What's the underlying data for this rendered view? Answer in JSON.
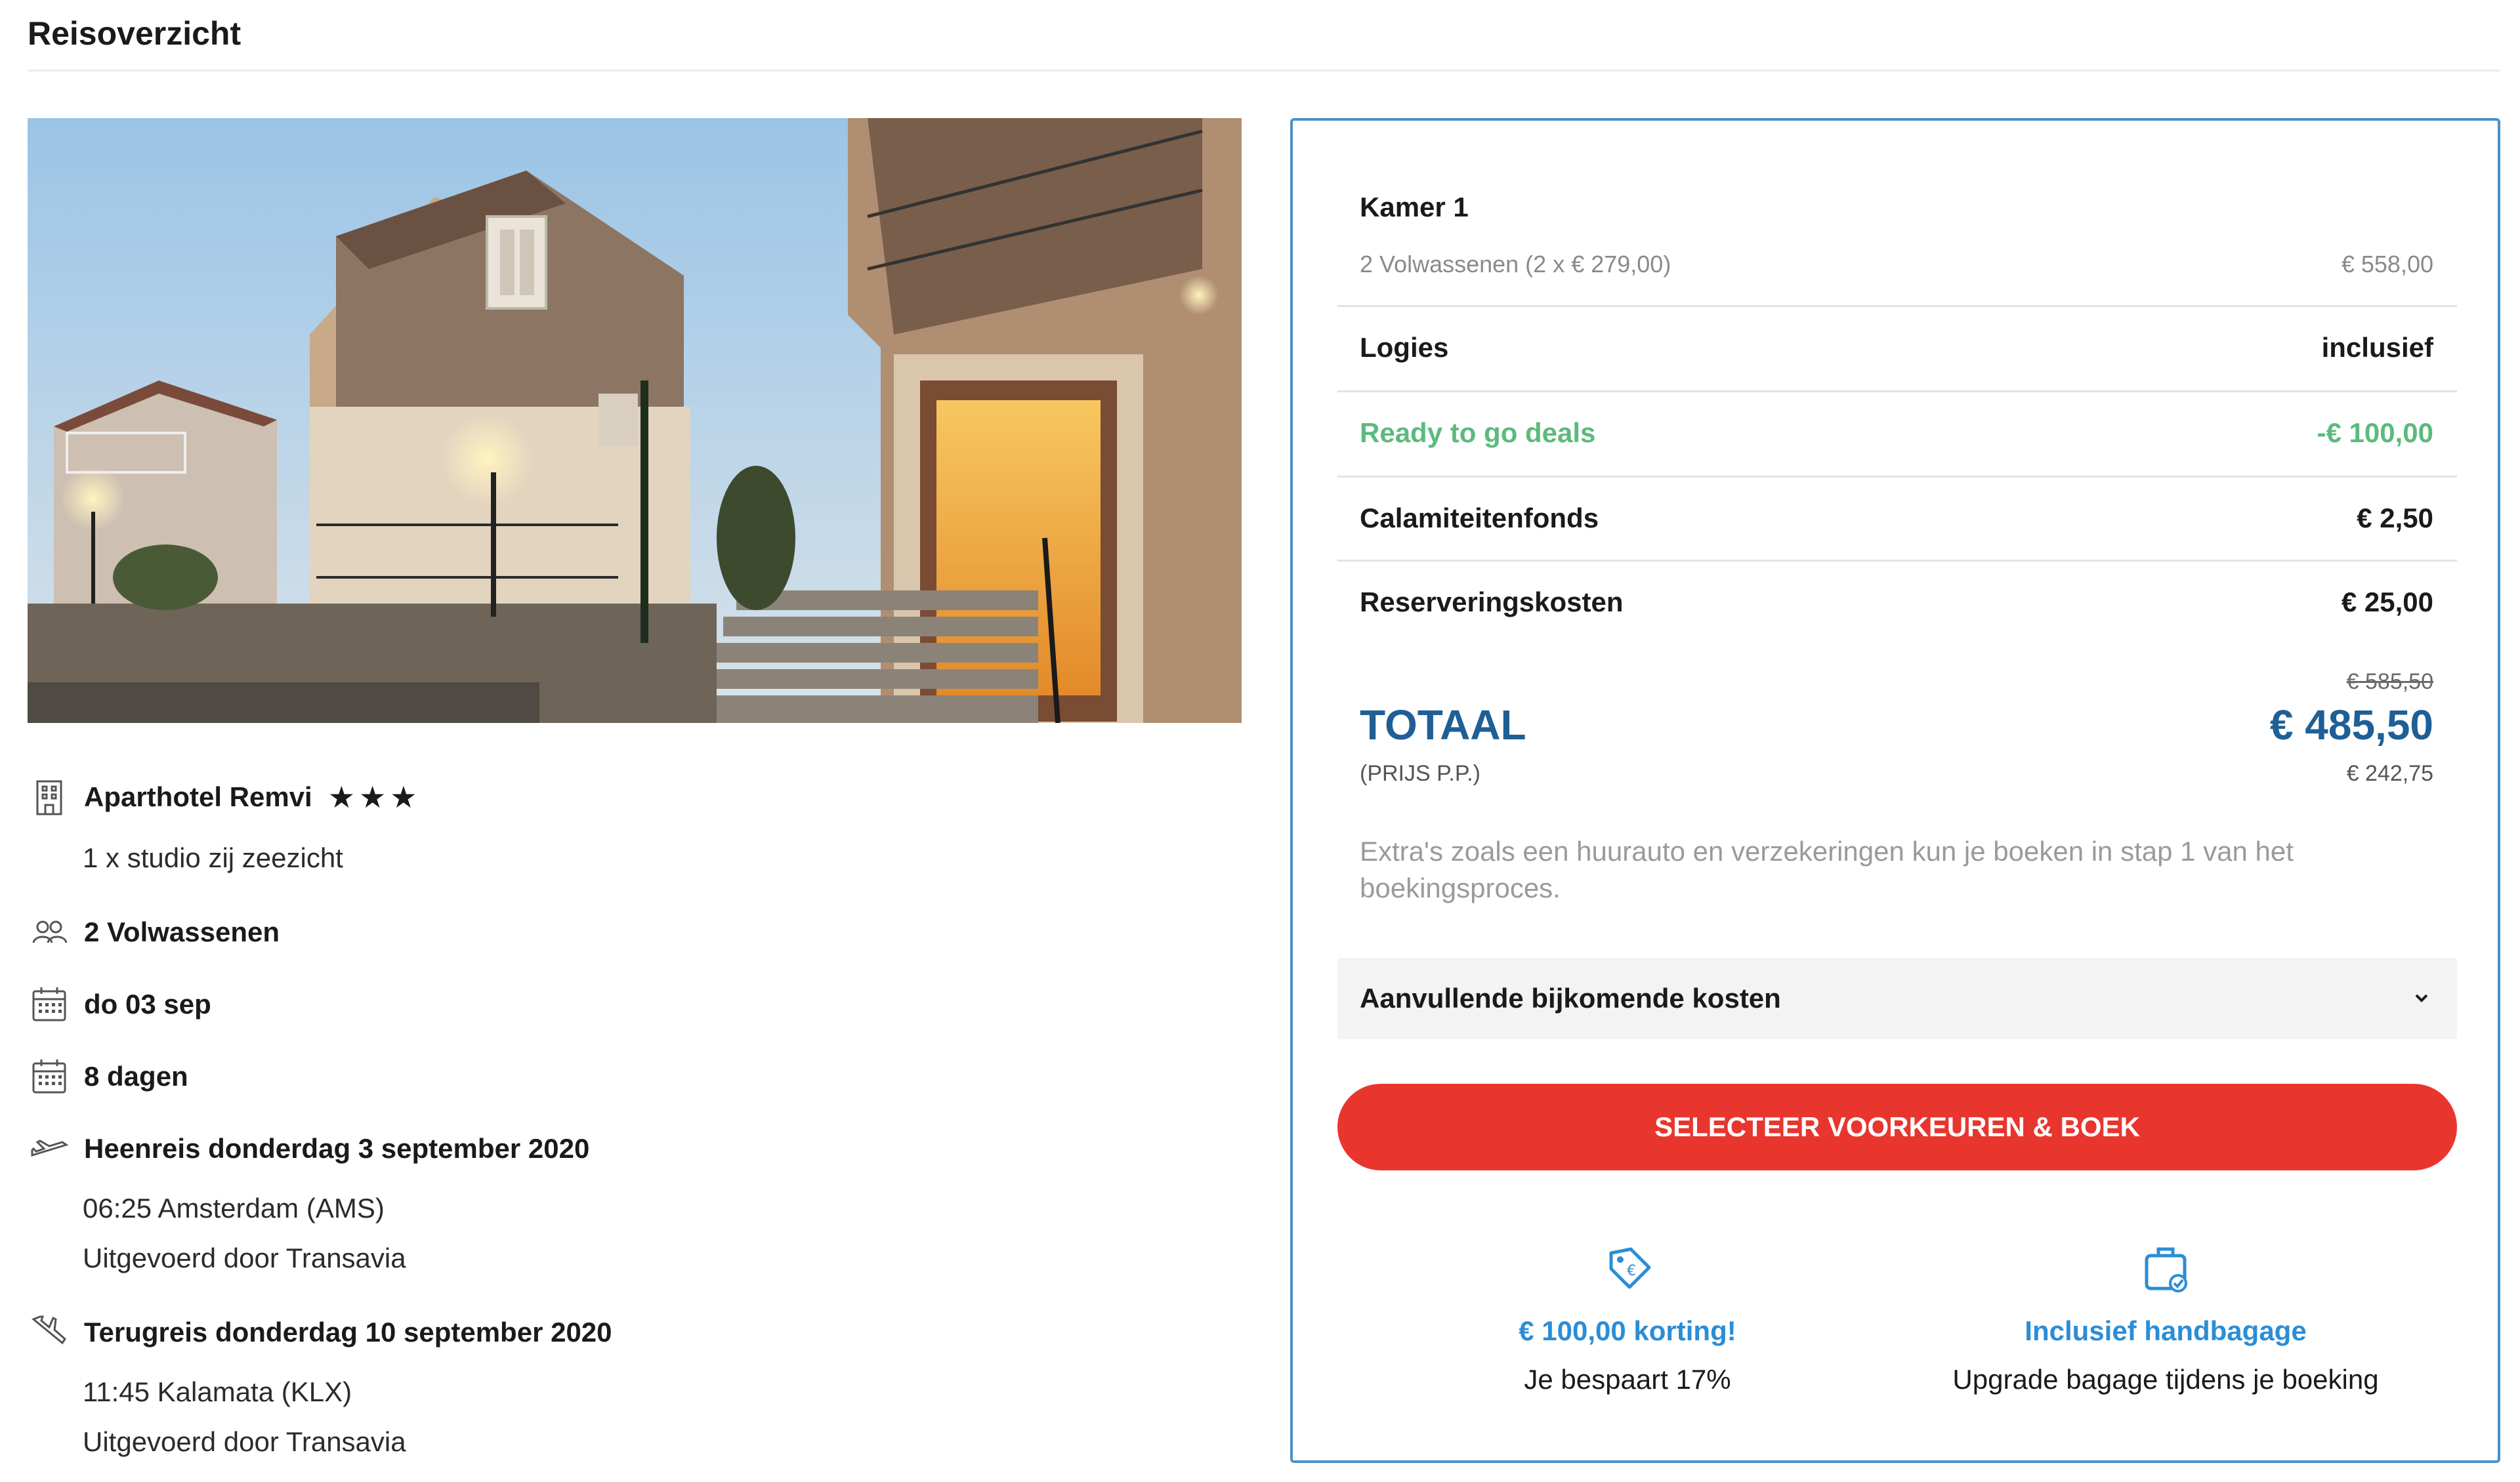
{
  "page": {
    "title": "Reisoverzicht"
  },
  "hotel": {
    "name": "Aparthotel Remvi",
    "stars": 3,
    "room": "1 x studio zij zeezicht"
  },
  "travellers": "2 Volwassenen",
  "departure_date": "do 03 sep",
  "duration": "8 dagen",
  "outbound": {
    "title": "Heenreis donderdag 3 september 2020",
    "time_place": "06:25 Amsterdam (AMS)",
    "operator": "Uitgevoerd door Transavia"
  },
  "return": {
    "title": "Terugreis donderdag 10 september 2020",
    "time_place": "11:45 Kalamata (KLX)",
    "operator": "Uitgevoerd door Transavia"
  },
  "summary": {
    "room_title": "Kamer 1",
    "room_detail": "2 Volwassenen (2 x € 279,00)",
    "room_price": "€ 558,00",
    "rows": [
      {
        "label": "Logies",
        "value": "inclusief"
      },
      {
        "label": "Ready to go deals",
        "value": "-€ 100,00"
      },
      {
        "label": "Calamiteitenfonds",
        "value": "€ 2,50"
      },
      {
        "label": "Reserveringskosten",
        "value": "€ 25,00"
      }
    ],
    "old_total": "€ 585,50",
    "total_label": "TOTAAL",
    "total_value": "€ 485,50",
    "pp_label": "(PRIJS P.P.)",
    "pp_value": "€ 242,75",
    "extras_note": "Extra's zoals een huurauto en verzekeringen kun je boeken in stap 1 van het boekingsproces.",
    "accordion_label": "Aanvullende bijkomende kosten",
    "book_button": "SELECTEER VOORKEUREN & BOEK"
  },
  "usps": [
    {
      "title": "€ 100,00 korting!",
      "text": "Je bespaart 17%",
      "icon": "price-tag-icon"
    },
    {
      "title": "Inclusief handbagage",
      "text": "Upgrade bagage tijdens je boeking",
      "icon": "luggage-icon"
    }
  ],
  "colors": {
    "primary_blue": "#1f5f96",
    "link_blue": "#2b8dd6",
    "deal_green": "#5cba7d",
    "cta_red": "#e8362f",
    "panel_border": "#4a90c8"
  }
}
